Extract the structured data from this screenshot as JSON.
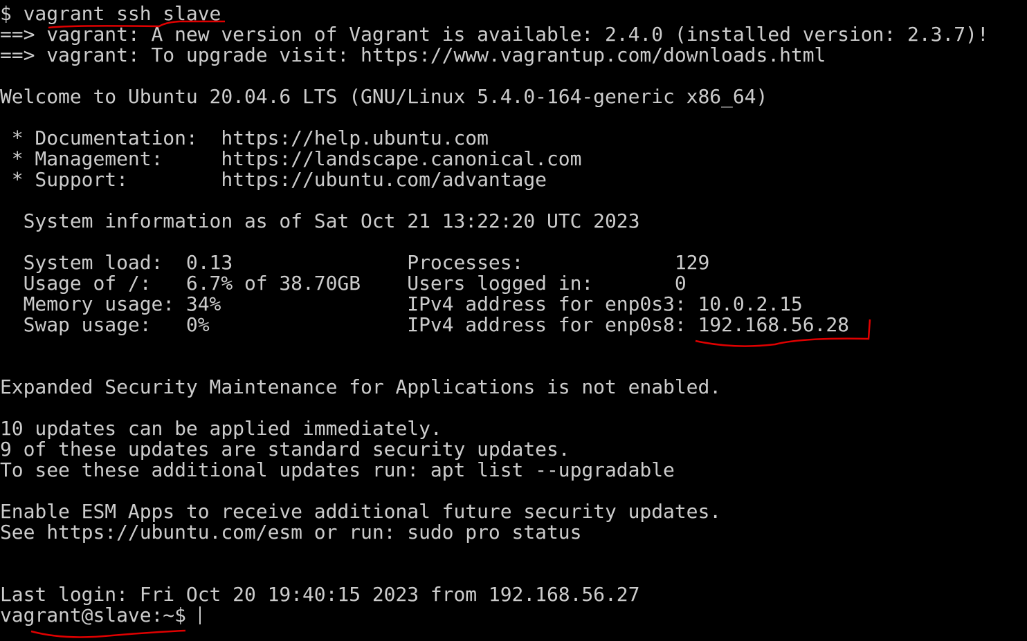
{
  "terminal": {
    "lines": [
      "$ vagrant ssh slave",
      "==> vagrant: A new version of Vagrant is available: 2.4.0 (installed version: 2.3.7)!",
      "==> vagrant: To upgrade visit: https://www.vagrantup.com/downloads.html",
      "",
      "Welcome to Ubuntu 20.04.6 LTS (GNU/Linux 5.4.0-164-generic x86_64)",
      "",
      " * Documentation:  https://help.ubuntu.com",
      " * Management:     https://landscape.canonical.com",
      " * Support:        https://ubuntu.com/advantage",
      "",
      "  System information as of Sat Oct 21 13:22:20 UTC 2023",
      "",
      "  System load:  0.13               Processes:             129",
      "  Usage of /:   6.7% of 38.70GB    Users logged in:       0",
      "  Memory usage: 34%                IPv4 address for enp0s3: 10.0.2.15",
      "  Swap usage:   0%                 IPv4 address for enp0s8: 192.168.56.28",
      "",
      "",
      "Expanded Security Maintenance for Applications is not enabled.",
      "",
      "10 updates can be applied immediately.",
      "9 of these updates are standard security updates.",
      "To see these additional updates run: apt list --upgradable",
      "",
      "Enable ESM Apps to receive additional future security updates.",
      "See https://ubuntu.com/esm or run: sudo pro status",
      "",
      "",
      "Last login: Fri Oct 20 19:40:15 2023 from 192.168.56.27"
    ],
    "prompt": "vagrant@slave:~$ "
  },
  "colors": {
    "text": "#cccccc",
    "background": "#000000",
    "annotation": "#e00000"
  }
}
